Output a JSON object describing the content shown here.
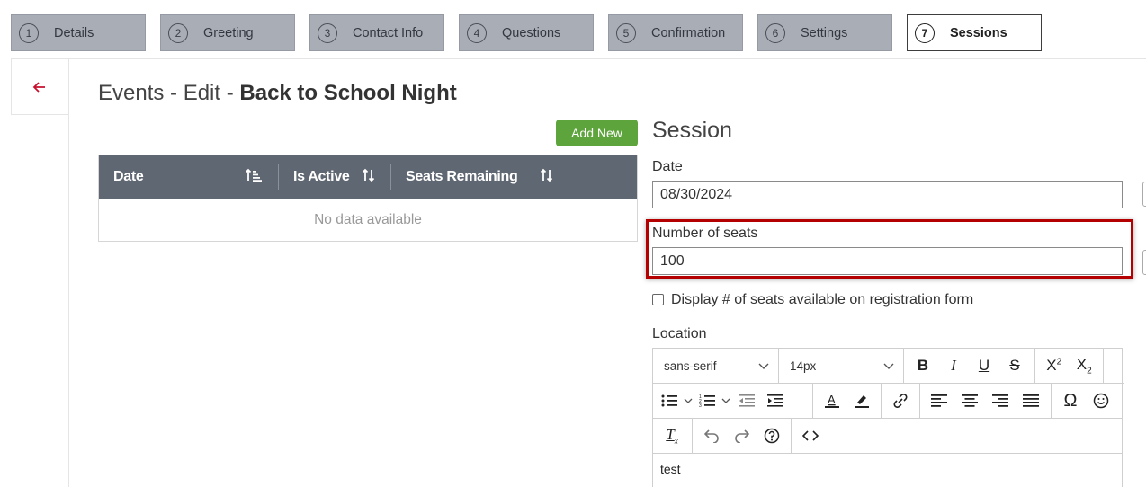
{
  "steps": [
    {
      "num": "1",
      "label": "Details"
    },
    {
      "num": "2",
      "label": "Greeting"
    },
    {
      "num": "3",
      "label": "Contact Info"
    },
    {
      "num": "4",
      "label": "Questions"
    },
    {
      "num": "5",
      "label": "Confirmation"
    },
    {
      "num": "6",
      "label": "Settings"
    },
    {
      "num": "7",
      "label": "Sessions"
    }
  ],
  "page": {
    "title_prefix": "Events - Edit - ",
    "title_name": "Back to School Night",
    "add_new": "Add New"
  },
  "grid": {
    "columns": [
      "Date",
      "Is Active",
      "Seats Remaining"
    ],
    "empty_text": "No data available"
  },
  "session": {
    "title": "Session",
    "date_label": "Date",
    "date_value": "08/30/2024",
    "seats_label": "Number of seats",
    "seats_value": "100",
    "display_checkbox_label": "Display # of seats available on registration form",
    "location_label": "Location",
    "font_family": "sans-serif",
    "font_size": "14px",
    "location_content": "test"
  },
  "colors": {
    "step_bg": "#a9adb6",
    "grid_header": "#5f6772",
    "add_button": "#5ea43c",
    "highlight": "#b40000",
    "back_arrow": "#c8102e"
  }
}
